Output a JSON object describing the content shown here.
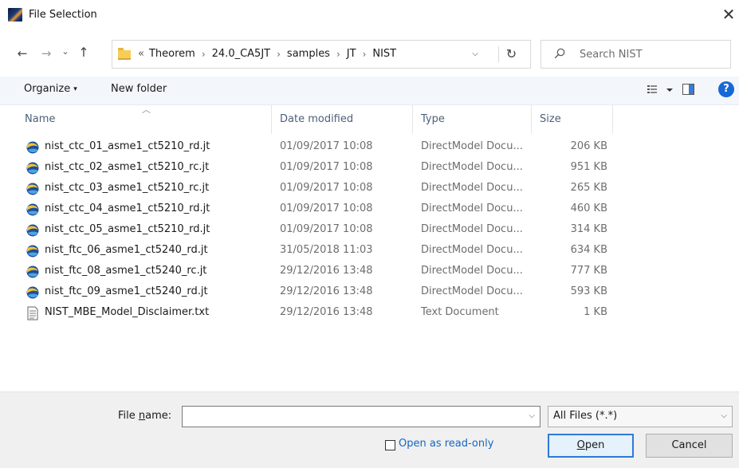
{
  "window": {
    "title": "File Selection",
    "close_glyph": "✕"
  },
  "nav": {
    "back_glyph": "←",
    "forward_glyph": "→",
    "recent_glyph": "⌄",
    "up_glyph": "↑"
  },
  "address": {
    "overflow": "«",
    "crumbs": [
      "Theorem",
      "24.0_CA5JT",
      "samples",
      "JT",
      "NIST"
    ],
    "separator": "›",
    "dropdown_glyph": "⌵",
    "refresh_glyph": "↻"
  },
  "search": {
    "placeholder": "Search NIST"
  },
  "toolbar": {
    "organize_label": "Organize",
    "organize_caret": "▾",
    "new_folder_label": "New folder",
    "help_label": "?"
  },
  "columns": {
    "name": "Name",
    "date": "Date modified",
    "type": "Type",
    "size": "Size"
  },
  "files": [
    {
      "name": "nist_ctc_01_asme1_ct5210_rd.jt",
      "date": "01/09/2017 10:08",
      "type": "DirectModel Docu...",
      "size": "206 KB",
      "icon": "jt-model-icon"
    },
    {
      "name": "nist_ctc_02_asme1_ct5210_rc.jt",
      "date": "01/09/2017 10:08",
      "type": "DirectModel Docu...",
      "size": "951 KB",
      "icon": "jt-model-icon"
    },
    {
      "name": "nist_ctc_03_asme1_ct5210_rc.jt",
      "date": "01/09/2017 10:08",
      "type": "DirectModel Docu...",
      "size": "265 KB",
      "icon": "jt-model-icon"
    },
    {
      "name": "nist_ctc_04_asme1_ct5210_rd.jt",
      "date": "01/09/2017 10:08",
      "type": "DirectModel Docu...",
      "size": "460 KB",
      "icon": "jt-model-icon"
    },
    {
      "name": "nist_ctc_05_asme1_ct5210_rd.jt",
      "date": "01/09/2017 10:08",
      "type": "DirectModel Docu...",
      "size": "314 KB",
      "icon": "jt-model-icon"
    },
    {
      "name": "nist_ftc_06_asme1_ct5240_rd.jt",
      "date": "31/05/2018 11:03",
      "type": "DirectModel Docu...",
      "size": "634 KB",
      "icon": "jt-model-icon"
    },
    {
      "name": "nist_ftc_08_asme1_ct5240_rc.jt",
      "date": "29/12/2016 13:48",
      "type": "DirectModel Docu...",
      "size": "777 KB",
      "icon": "jt-model-icon"
    },
    {
      "name": "nist_ftc_09_asme1_ct5240_rd.jt",
      "date": "29/12/2016 13:48",
      "type": "DirectModel Docu...",
      "size": "593 KB",
      "icon": "jt-model-icon"
    },
    {
      "name": "NIST_MBE_Model_Disclaimer.txt",
      "date": "29/12/2016 13:48",
      "type": "Text Document",
      "size": "1 KB",
      "icon": "text-file-icon"
    }
  ],
  "bottom": {
    "filename_label_prefix": "File ",
    "filename_label_accel": "n",
    "filename_label_suffix": "ame:",
    "filename_value": "",
    "filetype_value": "All Files (*.*)",
    "dropdown_glyph": "⌵",
    "readonly_label": "Open as read-only",
    "open_accel": "O",
    "open_rest": "pen",
    "cancel_label": "Cancel"
  },
  "colors": {
    "accent": "#2f7ad8",
    "help_blue": "#1668d6",
    "link_blue": "#1666c4",
    "toolbar_bg": "#f3f6fb",
    "header_text": "#4c607a"
  }
}
